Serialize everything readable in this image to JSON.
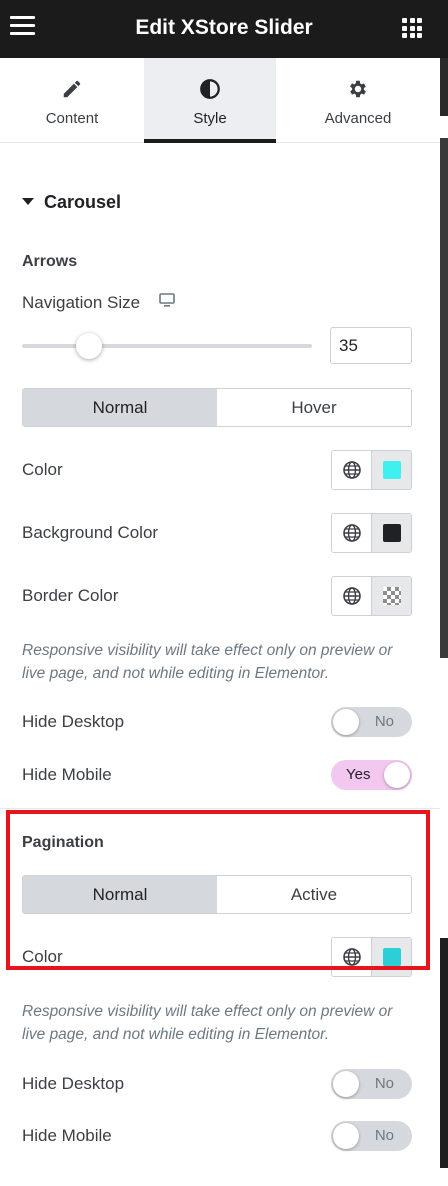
{
  "header": {
    "title": "Edit XStore Slider"
  },
  "tabs": [
    {
      "label": "Content",
      "icon": "pencil-icon"
    },
    {
      "label": "Style",
      "icon": "half-circle-icon"
    },
    {
      "label": "Advanced",
      "icon": "gear-icon"
    }
  ],
  "active_tab": "Style",
  "section": {
    "title": "Carousel"
  },
  "arrows": {
    "heading": "Arrows",
    "navigation_size_label": "Navigation Size",
    "navigation_size_value": "35",
    "navigation_size_fraction": 0.23,
    "state_tabs": [
      "Normal",
      "Hover"
    ],
    "color_label": "Color",
    "color_value": "#3ef0f0",
    "background_color_label": "Background Color",
    "background_color_value": "#1f2124",
    "border_color_label": "Border Color",
    "note": "Responsive visibility will take effect only on preview or live page, and not while editing in Elementor.",
    "hide_desktop_label": "Hide Desktop",
    "hide_desktop_value": "No",
    "hide_mobile_label": "Hide Mobile",
    "hide_mobile_value": "Yes"
  },
  "pagination": {
    "heading": "Pagination",
    "state_tabs": [
      "Normal",
      "Active"
    ],
    "color_label": "Color",
    "color_value": "#2ccfd6",
    "note": "Responsive visibility will take effect only on preview or live page, and not while editing in Elementor.",
    "hide_desktop_label": "Hide Desktop",
    "hide_desktop_value": "No",
    "hide_mobile_label": "Hide Mobile",
    "hide_mobile_value": "No"
  },
  "colors": {
    "header_bg": "#1b1b1c",
    "highlight": "#e8141d",
    "switch_on": "#f2c7f0"
  }
}
